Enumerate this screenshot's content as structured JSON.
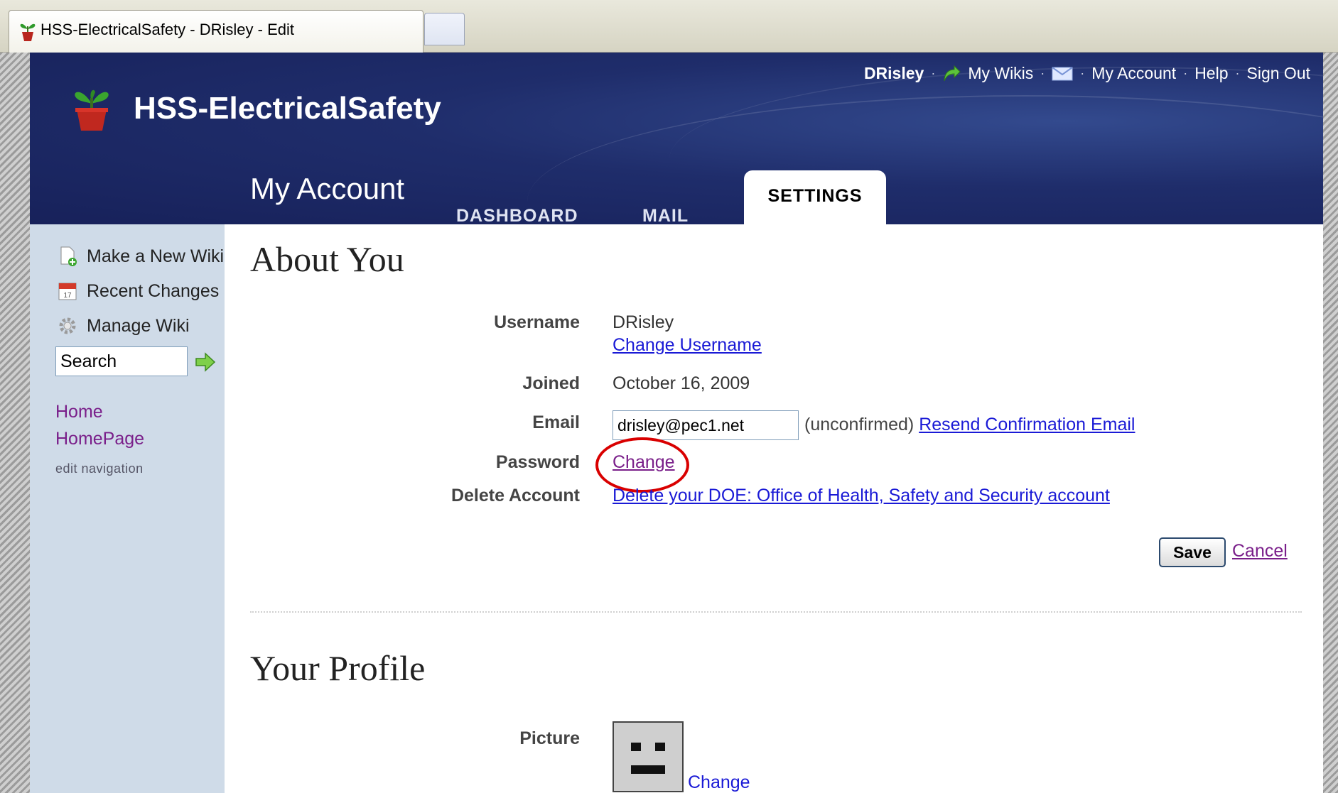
{
  "browser": {
    "tab_title": "HSS-ElectricalSafety - DRisley - Edit"
  },
  "header": {
    "wiki_name": "HSS-ElectricalSafety",
    "user": "DRisley",
    "my_wikis": "My Wikis",
    "my_account": "My Account",
    "help": "Help",
    "sign_out": "Sign Out",
    "separator": "·",
    "section_title": "My Account",
    "tabs": [
      {
        "label": "DASHBOARD",
        "active": false
      },
      {
        "label": "MAIL",
        "active": false
      },
      {
        "label": "SETTINGS",
        "active": true
      }
    ]
  },
  "sidebar": {
    "items": [
      {
        "label": "Make a New Wiki",
        "icon": "new-page-icon"
      },
      {
        "label": "Recent Changes",
        "icon": "calendar-icon"
      },
      {
        "label": "Manage Wiki",
        "icon": "gear-icon"
      }
    ],
    "search_value": "Search",
    "links": [
      "Home",
      "HomePage"
    ],
    "edit_navigation": "edit navigation"
  },
  "about": {
    "heading": "About You",
    "username_label": "Username",
    "username_value": "DRisley",
    "change_username": "Change Username",
    "joined_label": "Joined",
    "joined_value": "October 16, 2009",
    "email_label": "Email",
    "email_value": "drisley@pec1.net",
    "email_status": "(unconfirmed)",
    "resend_confirmation": "Resend Confirmation Email",
    "password_label": "Password",
    "password_change": "Change",
    "delete_label": "Delete Account",
    "delete_link": "Delete your DOE: Office of Health, Safety and Security account",
    "save": "Save",
    "cancel": "Cancel"
  },
  "profile": {
    "heading": "Your Profile",
    "picture_label": "Picture",
    "picture_change": "Change"
  },
  "annotation": {
    "highlight_color": "#d90000"
  }
}
